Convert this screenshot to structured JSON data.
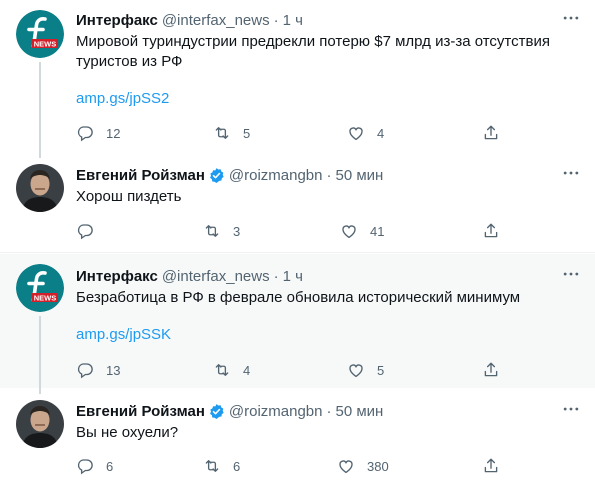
{
  "tweets": [
    {
      "author": "Интерфакс",
      "handle": "@interfax_news",
      "separator": "·",
      "time": "1 ч",
      "text_lines": [
        "Мировой туриндустрии предрекли потерю $7 млрд из-за отсутствия",
        "туристов из РФ"
      ],
      "link": "amp.gs/jpSS2",
      "replies": "12",
      "retweets": "5",
      "likes": "4",
      "verified": false
    },
    {
      "author": "Евгений Ройзман",
      "handle": "@roizmangbn",
      "separator": "·",
      "time": "50 мин",
      "text": "Хорош пиздеть",
      "replies": "",
      "retweets": "3",
      "likes": "41",
      "verified": true
    },
    {
      "author": "Интерфакс",
      "handle": "@interfax_news",
      "separator": "·",
      "time": "1 ч",
      "text": "Безработица в РФ в феврале обновила исторический минимум",
      "link": "amp.gs/jpSSK",
      "replies": "13",
      "retweets": "4",
      "likes": "5",
      "verified": false
    },
    {
      "author": "Евгений Ройзман",
      "handle": "@roizmangbn",
      "separator": "·",
      "time": "50 мин",
      "text": "Вы не охуели?",
      "replies": "6",
      "retweets": "6",
      "likes": "380",
      "verified": true
    }
  ],
  "colors": {
    "accent": "#1d9bf0",
    "muted": "#536471",
    "thread_line": "#cfd9de",
    "interfax_bg": "#0a7f88",
    "news_red": "#d4202a"
  },
  "icons": [
    "more-icon",
    "reply-icon",
    "retweet-icon",
    "like-icon",
    "share-icon",
    "verified-badge-icon",
    "interfax-logo"
  ]
}
